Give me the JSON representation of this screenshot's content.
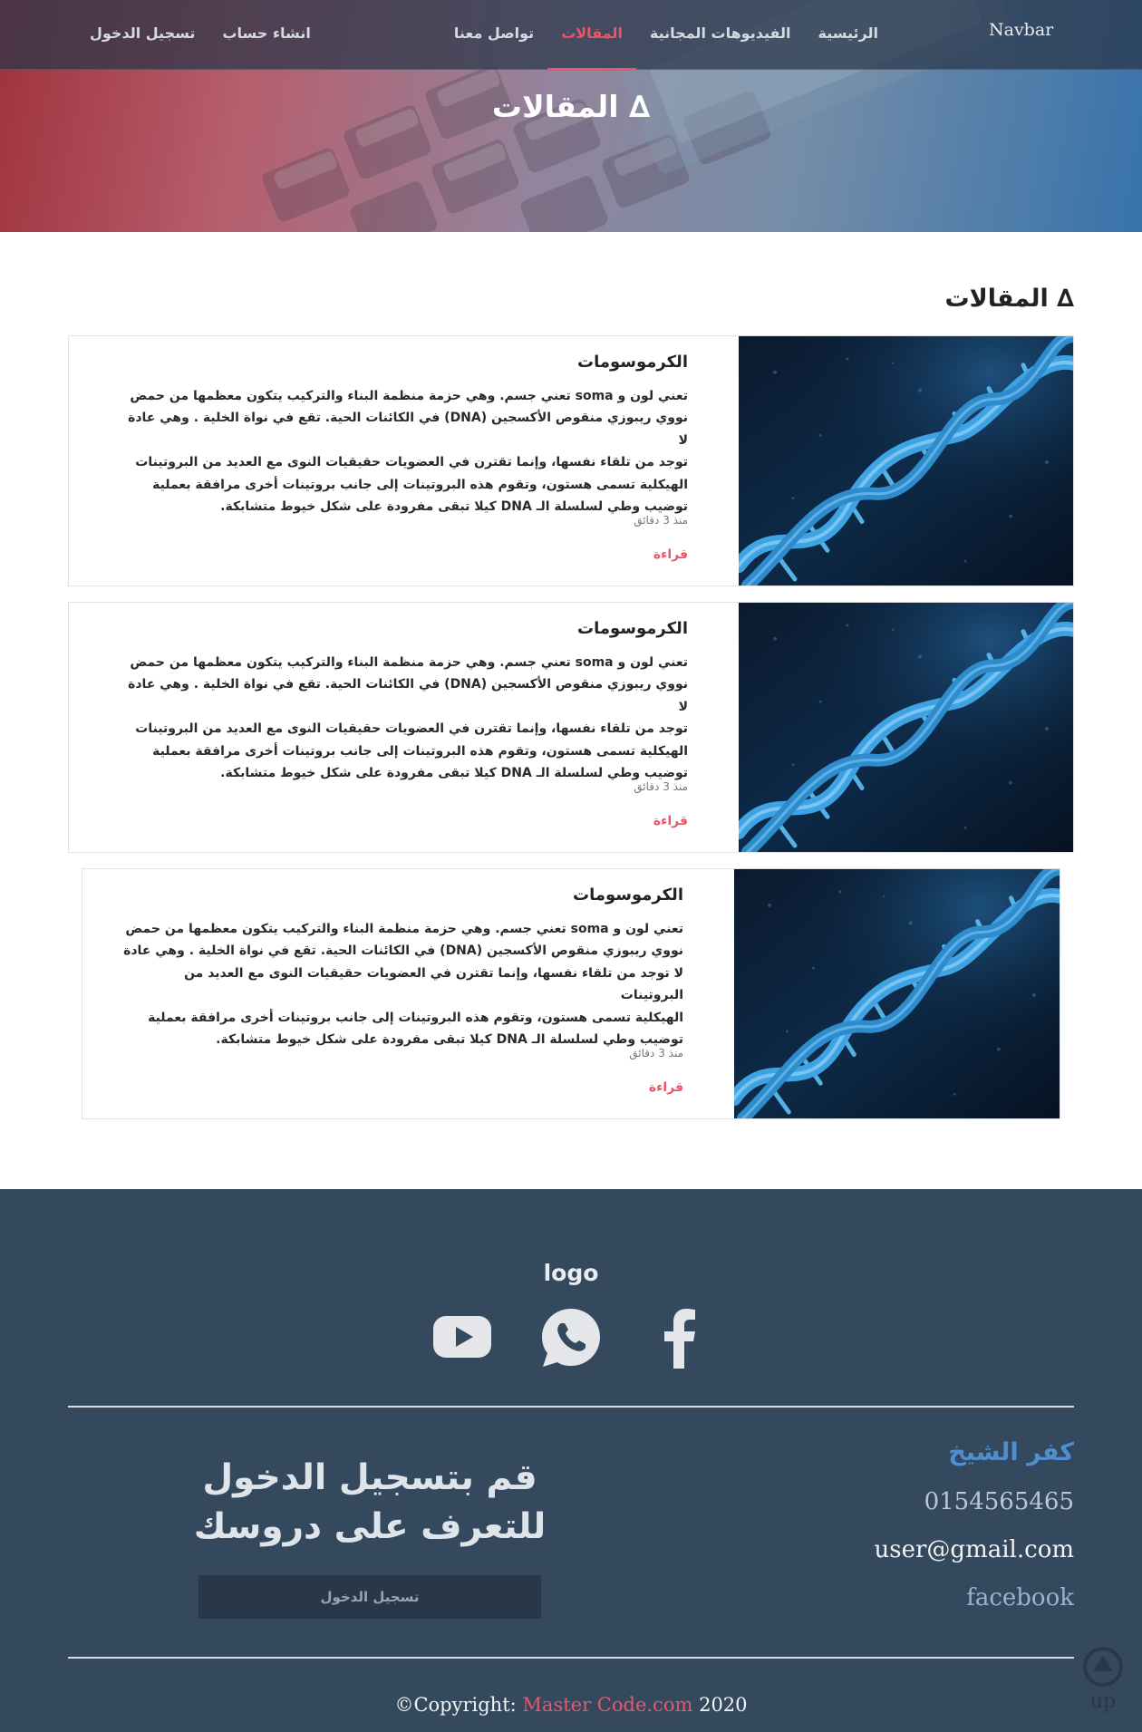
{
  "navbar": {
    "brand": "Navbar",
    "links": [
      {
        "label": "الرئيسية",
        "active": false
      },
      {
        "label": "الفيديوهات المجانية",
        "active": false
      },
      {
        "label": "المقالات",
        "active": true
      },
      {
        "label": "تواصل معنا",
        "active": false
      }
    ],
    "auth": {
      "login": "تسجيل الدخول",
      "register": "انشاء حساب"
    }
  },
  "hero": {
    "title": "∆ المقالات"
  },
  "section": {
    "title": "∆ المقالات"
  },
  "articles": [
    {
      "title": "الكرموسومات",
      "lines": [
        "تعني لون و soma تعني جسم. وهي حزمة منظمة البناء والتركيب يتكون معظمها من حمض",
        "نووي ريبوزي منقوص الأكسجين (DNA) في الكائنات الحية. تقع في نواة الخلية . وهي عادة لا",
        "توجد من تلقاء نفسها، وإنما تقترن في العضويات حقيقيات النوى مع العديد من البروتينات",
        "الهيكلية تسمى هستون، وتقوم هذه البروتينات إلى جانب بروتينات أخرى مرافقة بعملية",
        "توضيب وطي لسلسلة الـ DNA كيلا تبقى مفرودة على شكل خيوط متشابكة."
      ],
      "time": "منذ 3 دقائق",
      "read": "قراءة"
    },
    {
      "title": "الكرموسومات",
      "lines": [
        "تعني لون و soma تعني جسم. وهي حزمة منظمة البناء والتركيب يتكون معظمها من حمض",
        "نووي ريبوزي منقوص الأكسجين (DNA) في الكائنات الحية. تقع في نواة الخلية . وهي عادة لا",
        "توجد من تلقاء نفسها، وإنما تقترن في العضويات حقيقيات النوى مع العديد من البروتينات",
        "الهيكلية تسمى هستون، وتقوم هذه البروتينات إلى جانب بروتينات أخرى مرافقة بعملية",
        "توضيب وطي لسلسلة الـ DNA كيلا تبقى مفرودة على شكل خيوط متشابكة."
      ],
      "time": "منذ 3 دقائق",
      "read": "قراءة"
    },
    {
      "title": "الكرموسومات",
      "lines": [
        "تعني لون و soma تعني جسم. وهي حزمة منظمة البناء والتركيب يتكون معظمها من حمض",
        "نووي ريبوزي منقوص الأكسجين (DNA) في الكائنات الحية. تقع في نواة الخلية . وهي عادة",
        "لا توجد من تلقاء نفسها، وإنما تقترن في العضويات حقيقيات النوى مع العديد من البروتينات",
        "الهيكلية تسمى هستون، وتقوم هذه البروتينات إلى جانب بروتينات أخرى مرافقة بعملية",
        "توضيب وطي لسلسلة الـ DNA كيلا تبقى مفرودة على شكل خيوط متشابكة."
      ],
      "time": "منذ 3 دقائق",
      "read": "قراءة"
    }
  ],
  "footer": {
    "logo": "logo",
    "social": [
      "facebook-icon",
      "whatsapp-icon",
      "youtube-icon"
    ],
    "contact": {
      "city": "كفر الشيخ",
      "phone": "0154565465",
      "email": "user@gmail.com",
      "facebook": "facebook"
    },
    "cta": {
      "line1": "قم بتسجيل الدخول",
      "line2": "للتعرف على دروسك",
      "button": "تسجيل الدخول"
    },
    "copyright": {
      "prefix": "©Copyright:",
      "brand": "Master Code.com",
      "year": "2020"
    },
    "up_label": "up"
  },
  "colors": {
    "accent": "#e9566a",
    "footer_bg": "#34495e",
    "navbar_bg": "#2d3a4e",
    "link_blue": "#4e8fd0"
  }
}
